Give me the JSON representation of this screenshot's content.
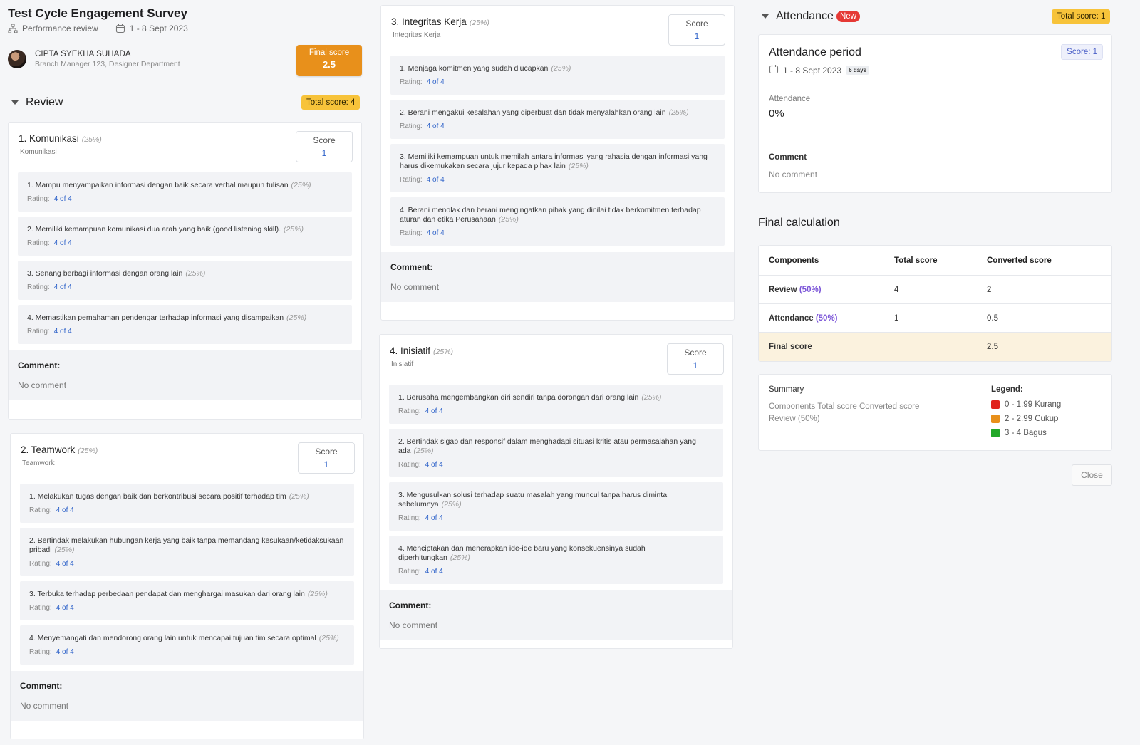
{
  "header": {
    "title": "Test Cycle Engagement Survey",
    "type": "Performance review",
    "period": "1 - 8 Sept 2023",
    "user": {
      "name": "CIPTA SYEKHA SUHADA",
      "role": "Branch Manager 123, Designer Department"
    },
    "final_score_label": "Final score",
    "final_score": "2.5"
  },
  "review": {
    "title": "Review",
    "total": "Total score: 4",
    "score_label": "Score",
    "rating_label": "Rating:",
    "comment_label": "Comment:",
    "cards": [
      {
        "name": "1. Komunikasi",
        "pct": "(25%)",
        "sub": "Komunikasi",
        "score": "1",
        "comment": "No comment",
        "items": [
          {
            "q": "1. Mampu menyampaikan informasi dengan baik secara verbal maupun tulisan",
            "pct": "(25%)",
            "rating": "4 of 4"
          },
          {
            "q": "2. Memiliki kemampuan komunikasi dua arah yang baik (good listening skill).",
            "pct": "(25%)",
            "rating": "4 of 4"
          },
          {
            "q": "3. Senang berbagi informasi dengan orang lain",
            "pct": "(25%)",
            "rating": "4 of 4"
          },
          {
            "q": "4. Memastikan pemahaman pendengar terhadap informasi yang disampaikan",
            "pct": "(25%)",
            "rating": "4 of 4"
          }
        ]
      },
      {
        "name": "2. Teamwork",
        "pct": "(25%)",
        "sub": "Teamwork",
        "score": "1",
        "comment": "No comment",
        "items": [
          {
            "q": "1. Melakukan tugas dengan baik dan berkontribusi secara positif terhadap tim",
            "pct": "(25%)",
            "rating": "4 of 4"
          },
          {
            "q": "2. Bertindak melakukan hubungan kerja yang baik tanpa memandang kesukaan/ketidaksukaan pribadi",
            "pct": "(25%)",
            "rating": "4 of 4"
          },
          {
            "q": "3. Terbuka terhadap perbedaan pendapat dan menghargai masukan dari orang lain",
            "pct": "(25%)",
            "rating": "4 of 4"
          },
          {
            "q": "4. Menyemangati dan mendorong orang lain untuk mencapai tujuan tim secara optimal",
            "pct": "(25%)",
            "rating": "4 of 4"
          }
        ]
      },
      {
        "name": "3. Integritas Kerja",
        "pct": "(25%)",
        "sub": "Integritas Kerja",
        "score": "1",
        "comment": "No comment",
        "items": [
          {
            "q": "1. Menjaga komitmen yang sudah diucapkan",
            "pct": "(25%)",
            "rating": "4 of 4"
          },
          {
            "q": "2. Berani mengakui kesalahan yang diperbuat dan tidak menyalahkan orang lain",
            "pct": "(25%)",
            "rating": "4 of 4"
          },
          {
            "q": "3. Memiliki kemampuan untuk memilah antara informasi yang rahasia dengan informasi yang harus dikemukakan secara jujur kepada pihak lain",
            "pct": "(25%)",
            "rating": "4 of 4"
          },
          {
            "q": "4. Berani menolak dan berani mengingatkan pihak yang dinilai tidak berkomitmen terhadap aturan dan etika Perusahaan",
            "pct": "(25%)",
            "rating": "4 of 4"
          }
        ]
      },
      {
        "name": "4. Inisiatif",
        "pct": "(25%)",
        "sub": "Inisiatif",
        "score": "1",
        "comment": "No comment",
        "items": [
          {
            "q": "1. Berusaha mengembangkan diri sendiri tanpa dorongan dari orang lain",
            "pct": "(25%)",
            "rating": "4 of 4"
          },
          {
            "q": "2. Bertindak sigap dan responsif dalam menghadapi situasi kritis atau permasalahan yang ada",
            "pct": "(25%)",
            "rating": "4 of 4"
          },
          {
            "q": "3. Mengusulkan solusi terhadap suatu masalah yang muncul tanpa harus diminta sebelumnya",
            "pct": "(25%)",
            "rating": "4 of 4"
          },
          {
            "q": "4. Menciptakan dan menerapkan ide-ide baru yang konsekuensinya sudah diperhitungkan",
            "pct": "(25%)",
            "rating": "4 of 4"
          }
        ]
      }
    ]
  },
  "attendance": {
    "title": "Attendance",
    "new_badge": "New",
    "total": "Total score: 1",
    "period_title": "Attendance period",
    "period": "1 - 8 Sept 2023",
    "days": "6 days",
    "score": "Score: 1",
    "attendance_label": "Attendance",
    "attendance_value": "0%",
    "comment_label": "Comment",
    "comment": "No comment"
  },
  "final_calc": {
    "title": "Final calculation",
    "headers": [
      "Components",
      "Total score",
      "Converted score"
    ],
    "rows": [
      {
        "name": "Review",
        "pct": "(50%)",
        "total": "4",
        "converted": "2"
      },
      {
        "name": "Attendance",
        "pct": "(50%)",
        "total": "1",
        "converted": "0.5"
      }
    ],
    "final_label": "Final score",
    "final_value": "2.5"
  },
  "summary": {
    "title": "Summary",
    "line1": "Components Total score Converted score",
    "line2": "Review (50%)",
    "legend_title": "Legend:",
    "legend": [
      {
        "label": "0 - 1.99 Kurang",
        "color": "#e0231c"
      },
      {
        "label": "2 - 2.99 Cukup",
        "color": "#e8901b"
      },
      {
        "label": "3 - 4 Bagus",
        "color": "#22a829"
      }
    ]
  },
  "close_label": "Close"
}
